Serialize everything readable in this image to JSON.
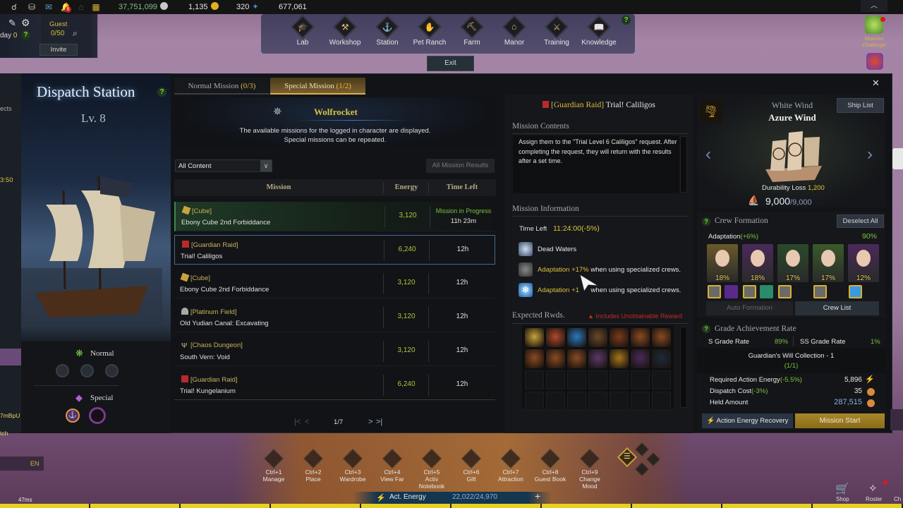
{
  "topbar": {
    "notification_count": "6",
    "silver": "37,751,099",
    "gold": "1,135",
    "blue_crystal": "320",
    "pheons": "677,061"
  },
  "lefthud": {
    "day_label": "day",
    "day_value": "0",
    "guest_label": "Guest",
    "guest_count": "0/50",
    "invite_label": "Invite",
    "side_texts": [
      "ects",
      "3:50",
      "7mBpU",
      "tch",
      "EN",
      "47ms"
    ]
  },
  "buildings": [
    {
      "label": "Lab",
      "icon": "lab-icon",
      "glyph": "🎓"
    },
    {
      "label": "Workshop",
      "icon": "workshop-icon",
      "glyph": "⚒"
    },
    {
      "label": "Station",
      "icon": "anchor-icon",
      "glyph": "⚓"
    },
    {
      "label": "Pet Ranch",
      "icon": "pet-ranch-icon",
      "glyph": "✋"
    },
    {
      "label": "Farm",
      "icon": "farm-icon",
      "glyph": "⛏"
    },
    {
      "label": "Manor",
      "icon": "manor-icon",
      "glyph": "⌂"
    },
    {
      "label": "Training",
      "icon": "training-icon",
      "glyph": "⚔"
    },
    {
      "label": "Knowledge",
      "icon": "book-icon",
      "glyph": "📖"
    }
  ],
  "exit_label": "Exit",
  "right_hud": {
    "mokoko_label": "Mokoko Challenge"
  },
  "dispatch": {
    "title": "Dispatch Station",
    "level": "Lv. 8",
    "normal_label": "Normal",
    "special_label": "Special"
  },
  "tabs": [
    {
      "label": "Normal Mission",
      "count": "(0/3)",
      "active": false
    },
    {
      "label": "Special Mission",
      "count": "(1/2)",
      "active": true
    }
  ],
  "character": {
    "name": "Wolfrocket",
    "desc1": "The available missions for the logged in character are displayed.",
    "desc2": "Special missions can be repeated."
  },
  "filter": {
    "selected": "All Content",
    "results_button": "All Mission Results"
  },
  "table": {
    "headers": {
      "mission": "Mission",
      "energy": "Energy",
      "time": "Time Left"
    },
    "rows": [
      {
        "category": "[Cube]",
        "icon": "cube-icon",
        "name": "Ebony Cube 2nd Forbiddance",
        "energy": "3,120",
        "status": "Mission in Progress",
        "time": "11h 23m",
        "state": "in-progress"
      },
      {
        "category": "[Guardian Raid]",
        "icon": "guardian-raid-icon",
        "name": "Trial! Caliligos",
        "energy": "6,240",
        "time": "12h",
        "state": "selected"
      },
      {
        "category": "[Cube]",
        "icon": "cube-icon",
        "name": "Ebony Cube 2nd Forbiddance",
        "energy": "3,120",
        "time": "12h",
        "state": "normal"
      },
      {
        "category": "[Platinum Field]",
        "icon": "platinum-field-icon",
        "name": "Old Yudian Canal: Excavating",
        "energy": "3,120",
        "time": "12h",
        "state": "normal"
      },
      {
        "category": "[Chaos Dungeon]",
        "icon": "chaos-dungeon-icon",
        "name": "South Vern: Void",
        "energy": "3,120",
        "time": "12h",
        "state": "normal"
      },
      {
        "category": "[Guardian Raid]",
        "icon": "guardian-raid-icon",
        "name": "Trial! Kungelanium",
        "energy": "6,240",
        "time": "12h",
        "state": "normal"
      }
    ],
    "page": "1/7"
  },
  "detail": {
    "category": "[Guardian Raid]",
    "title": "Trial! Caliligos",
    "contents_head": "Mission Contents",
    "contents_text": "Assign them to the \"Trial Level 6 Caliligos\" request. After completing the request, they will return with the results after a set time.",
    "info_head": "Mission Information",
    "time_left_label": "Time Left",
    "time_left_value": "11:24:00(-5%)",
    "condition": "Dead Waters",
    "bonus1_hl": "Adaptation +17%",
    "bonus1_text": " when using specialized crews.",
    "bonus2_hl": "Adaptation +1",
    "bonus2_text": " when using specialized crews.",
    "rewards_head": "Expected Rwds.",
    "rewards_warning": "Includes Unobtainable Reward",
    "rewards": [
      {
        "name": "guardian-seal",
        "color": "#c9a23a"
      },
      {
        "name": "destruction-stone",
        "color": "#b04a2a"
      },
      {
        "name": "guardian-stone",
        "color": "#2a7ac0"
      },
      {
        "name": "leapstone",
        "color": "#6a4a2a"
      },
      {
        "name": "earring",
        "color": "#7a3a1a"
      },
      {
        "name": "ring",
        "color": "#8a4a22"
      },
      {
        "name": "ring",
        "color": "#8a4a22"
      },
      {
        "name": "ring",
        "color": "#8a4a22"
      },
      {
        "name": "ring",
        "color": "#8a4a22"
      },
      {
        "name": "bracelet",
        "color": "#8a4a22"
      },
      {
        "name": "crystal-ore",
        "color": "#5a3a6a"
      },
      {
        "name": "book",
        "color": "#a8761a"
      },
      {
        "name": "card",
        "color": "#4a2a5a"
      },
      {
        "name": "potion",
        "color": "#1e2a3a"
      }
    ]
  },
  "ship": {
    "type": "White Wind",
    "name": "Azure Wind",
    "ship_list": "Ship List",
    "durability_label": "Durability Loss",
    "durability_value": "1,200",
    "current": "9,000",
    "max": "/9,000"
  },
  "crew": {
    "head": "Crew Formation",
    "deselect": "Deselect All",
    "adaptation_label": "Adaptation",
    "adaptation_bonus": "(+6%)",
    "adaptation_total": "90%",
    "members": [
      {
        "pct": "18%",
        "bg": "#6a5a2a"
      },
      {
        "pct": "18%",
        "bg": "#4a2a5a"
      },
      {
        "pct": "17%",
        "bg": "#2a4a2a"
      },
      {
        "pct": "17%",
        "bg": "#3a5a2a"
      },
      {
        "pct": "12%",
        "bg": "#4a2a5a"
      }
    ],
    "auto": "Auto Formation",
    "list": "Crew List"
  },
  "grade": {
    "head": "Grade Achievement Rate",
    "s_label": "S Grade Rate",
    "s_value": "89%",
    "ss_label": "SS Grade Rate",
    "ss_value": "1%",
    "collection": "Guardian's Will Collection - 1",
    "collection_count": "(1/1)",
    "energy_label": "Required Action Energy",
    "energy_mod": "(-5.5%)",
    "energy_value": "5,896",
    "cost_label": "Dispatch Cost",
    "cost_mod": "(-3%)",
    "cost_value": "35",
    "held_label": "Held Amount",
    "held_value": "287,515",
    "recovery_btn": "Action Energy Recovery",
    "start_btn": "Mission Start"
  },
  "hotbar": [
    {
      "key": "Ctrl+1",
      "label": "Manage"
    },
    {
      "key": "Ctrl+2",
      "label": "Place"
    },
    {
      "key": "Ctrl+3",
      "label": "Wardrobe"
    },
    {
      "key": "Ctrl+4",
      "label": "View Far"
    },
    {
      "key": "Ctrl+5",
      "label": "Activ Notebook"
    },
    {
      "key": "Ctrl+6",
      "label": "Gift"
    },
    {
      "key": "Ctrl+7",
      "label": "Attraction"
    },
    {
      "key": "Ctrl+8",
      "label": "Guest Book"
    },
    {
      "key": "Ctrl+9",
      "label": "Change Mood"
    }
  ],
  "energy_bar": {
    "label": "Act. Energy",
    "value": "22,022/24,970"
  },
  "bottom_right": {
    "shop": "Shop",
    "roster": "Roster",
    "cha": "Ch"
  }
}
